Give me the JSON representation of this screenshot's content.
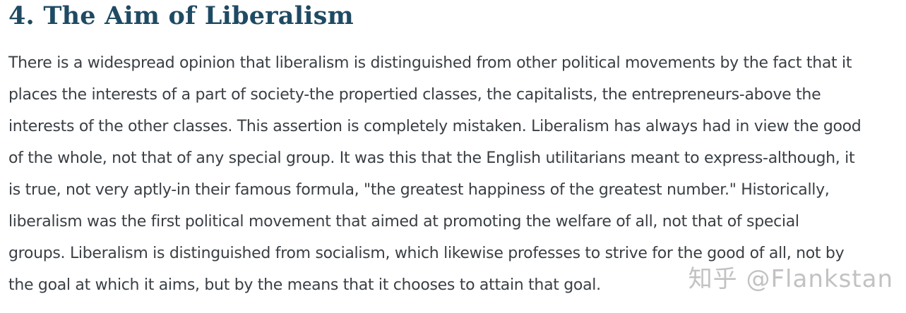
{
  "heading": "4. The Aim of Liberalism",
  "paragraph": {
    "lines": [
      "There is a widespread opinion that liberalism is distinguished from other political movements by the fact that it",
      "places the interests of a part of society-the propertied classes, the capitalists, the entrepreneurs-above the",
      "interests of the other classes. This assertion is completely mistaken. Liberalism has always had in view the good",
      "of the whole, not that of any special group. It was this that the English utilitarians meant to express-although, it",
      "is true, not very aptly-in their famous formula, \"the greatest happiness of the greatest number.\" Historically,",
      "liberalism was the first political movement that aimed at promoting the welfare of all, not that of special",
      "groups. Liberalism is distinguished from socialism, which likewise professes to strive for the good of all, not by",
      "the goal at which it aims, but by the means that it chooses to attain that goal."
    ]
  },
  "watermark": "知乎 @Flankstan",
  "colors": {
    "heading": "#1f4a63",
    "body": "#3a3f44",
    "background": "#ffffff"
  }
}
